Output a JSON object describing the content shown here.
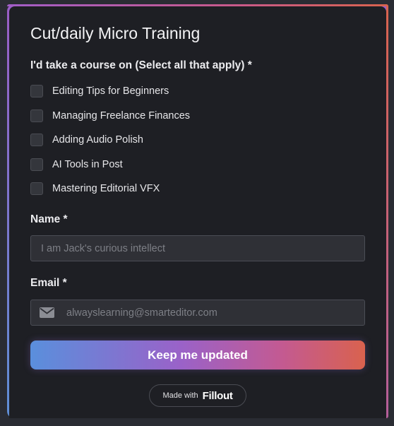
{
  "form": {
    "title": "Cut/daily Micro Training",
    "question": "I'd take a course on (Select all that apply) *",
    "options": [
      {
        "label": "Editing Tips for Beginners",
        "checked": false
      },
      {
        "label": "Managing Freelance Finances",
        "checked": false
      },
      {
        "label": "Adding Audio Polish",
        "checked": false
      },
      {
        "label": "AI Tools in Post",
        "checked": false
      },
      {
        "label": "Mastering Editorial VFX",
        "checked": false
      }
    ],
    "name_label": "Name *",
    "name_placeholder": "I am Jack's curious intellect",
    "name_value": "",
    "email_label": "Email *",
    "email_icon": "envelope-icon",
    "email_placeholder": "alwayslearning@smarteditor.com",
    "email_value": "",
    "submit_label": "Keep me updated"
  },
  "footer": {
    "made_with": "Made with",
    "brand": "Fillout"
  },
  "colors": {
    "background": "#1e1f24",
    "page": "#2a2c33",
    "input_bg": "#2f3036",
    "button_gradient_start": "#5a8fdc",
    "button_gradient_mid": "#9a62c8",
    "button_gradient_end": "#d9624e"
  }
}
